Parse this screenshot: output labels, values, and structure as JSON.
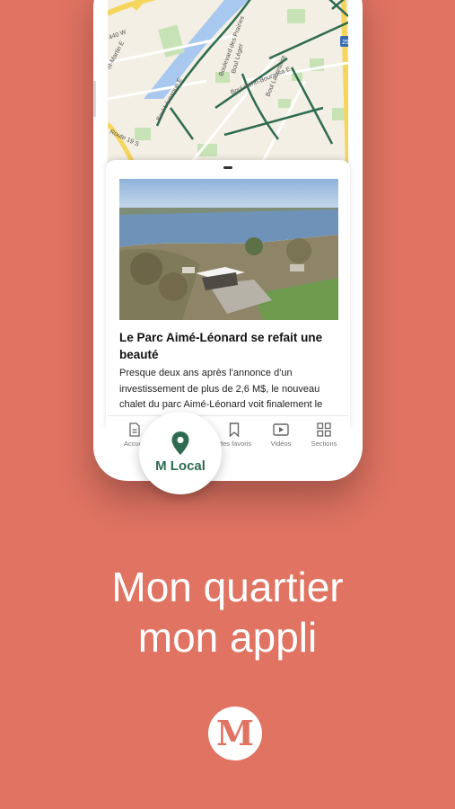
{
  "colors": {
    "background": "#E07362",
    "accent_green": "#2E6B50",
    "map_land": "#F3EFE4",
    "map_water": "#A9C8EF"
  },
  "map": {
    "labels": [
      "440 W",
      "St-Martin E",
      "Boulevard des Prairies",
      "Boul Léger",
      "Boul Henri-Bourassa E",
      "Boul Lacordaire",
      "Boul Lévesque E",
      "Route 19 S"
    ],
    "highway_badge": "25"
  },
  "article": {
    "title": "Le Parc Aimé-Léonard se refait une beauté",
    "excerpt": "Presque deux ans après l'annonce d'un investissement de plus de 2,6 M$, le nouveau chalet du parc Aimé-Léonard voit finalement le jour. Une nouvelle"
  },
  "tabbar": {
    "tabs": [
      {
        "label": "Accueil",
        "icon": "document-icon"
      },
      {
        "label": "Mes favoris",
        "icon": "bookmark-icon"
      },
      {
        "label": "Vidéos",
        "icon": "play-icon"
      },
      {
        "label": "Sections",
        "icon": "grid-icon"
      }
    ],
    "featured": {
      "label": "M Local",
      "icon": "map-pin-icon"
    }
  },
  "tagline": {
    "line1": "Mon quartier",
    "line2": "mon appli"
  },
  "logo": {
    "letter": "M"
  }
}
